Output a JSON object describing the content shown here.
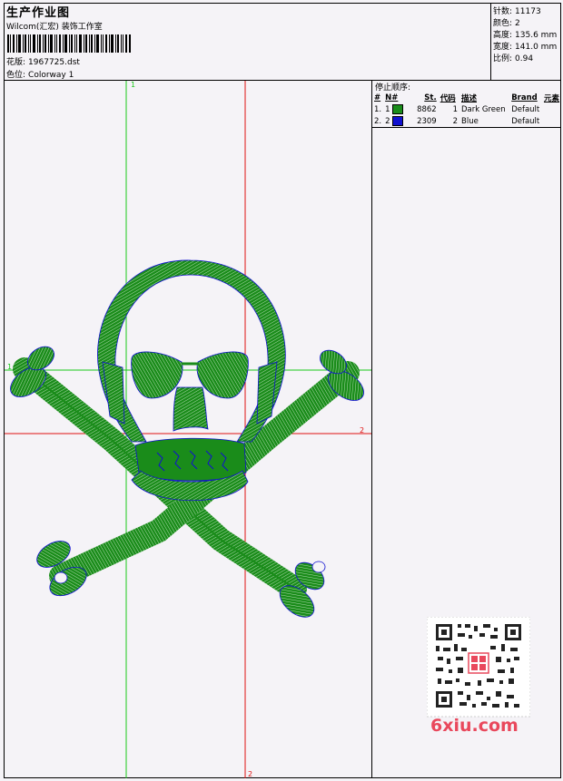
{
  "header": {
    "title": "生产作业图",
    "studio": "Wilcom(汇宏) 装饰工作室",
    "design_label": "花版:",
    "design_value": "1967725.dst",
    "colorway_label": "色位:",
    "colorway_value": "Colorway 1"
  },
  "stats": {
    "stitches_label": "针数:",
    "stitches_value": "11173",
    "colors_label": "颜色:",
    "colors_value": "2",
    "height_label": "高度:",
    "height_value": "135.6 mm",
    "width_label": "宽度:",
    "width_value": "141.0 mm",
    "scale_label": "比例:",
    "scale_value": "0.94"
  },
  "stop_sequence": {
    "title": "停止顺序:",
    "headers": [
      "#",
      "N#",
      "St.",
      "代码",
      "描述",
      "Brand",
      "元素"
    ],
    "rows": [
      {
        "idx": "1.",
        "n": "1",
        "color": "#1a8c1a",
        "st": "8862",
        "code": "1",
        "desc": "Dark Green",
        "brand": "Default",
        "element": ""
      },
      {
        "idx": "2.",
        "n": "2",
        "color": "#1010d0",
        "st": "2309",
        "code": "2",
        "desc": "Blue",
        "brand": "Default",
        "element": ""
      }
    ]
  },
  "guides": {
    "v1_label": "1",
    "h1_label": "1",
    "h2_label": "2",
    "v2_label": "2"
  },
  "colors": {
    "stitch_green": "#1a8c1a",
    "stitch_blue": "#1010d0",
    "guide_green": "#19c819",
    "guide_red": "#e01010"
  },
  "watermark": {
    "text": "6xiu.com"
  }
}
